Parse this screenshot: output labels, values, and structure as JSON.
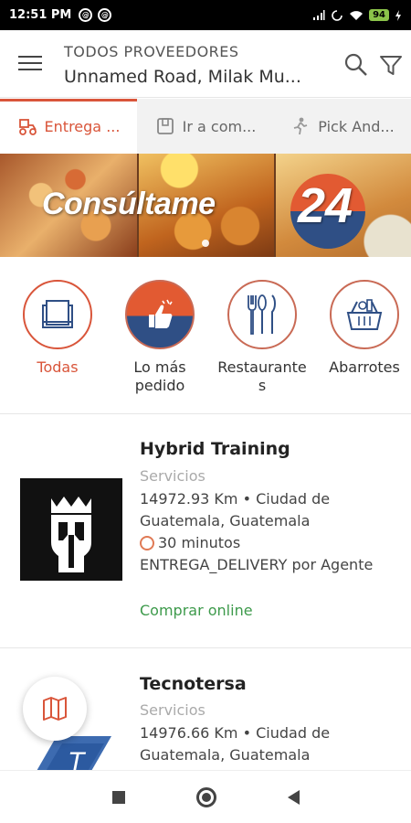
{
  "status_bar": {
    "time": "12:51 PM",
    "battery": "94"
  },
  "header": {
    "title": "TODOS PROVEEDORES",
    "address": "Unnamed Road, Milak Mu..."
  },
  "tabs": [
    {
      "label": "Entrega ...",
      "icon": "delivery-icon",
      "active": true
    },
    {
      "label": "Ir a com...",
      "icon": "store-icon",
      "active": false
    },
    {
      "label": "Pick And...",
      "icon": "pickup-icon",
      "active": false
    }
  ],
  "banner": {
    "brand_text": "Consúltame",
    "brand_number": "24"
  },
  "categories": [
    {
      "label": "Todas",
      "icon": "all-items-icon",
      "active": true
    },
    {
      "label": "Lo más pedido",
      "icon": "thumbs-up-icon",
      "active": false
    },
    {
      "label": "Restaurantes",
      "icon": "cutlery-icon",
      "active": false
    },
    {
      "label": "Abarrotes",
      "icon": "grocery-basket-icon",
      "active": false
    }
  ],
  "providers": [
    {
      "name": "Hybrid Training",
      "category": "Servicios",
      "distance_location": "14972.93 Km • Ciudad de Guatemala, Guatemala",
      "time": "30 minutos",
      "delivery": "ENTREGA_DELIVERY por Agente",
      "action": "Comprar online"
    },
    {
      "name": "Tecnotersa",
      "category": "Servicios",
      "distance_location": "14976.66 Km • Ciudad de Guatemala, Guatemala"
    }
  ],
  "colors": {
    "accent": "#d9553a",
    "green": "#3d9a4b",
    "navy": "#2f4f85"
  }
}
